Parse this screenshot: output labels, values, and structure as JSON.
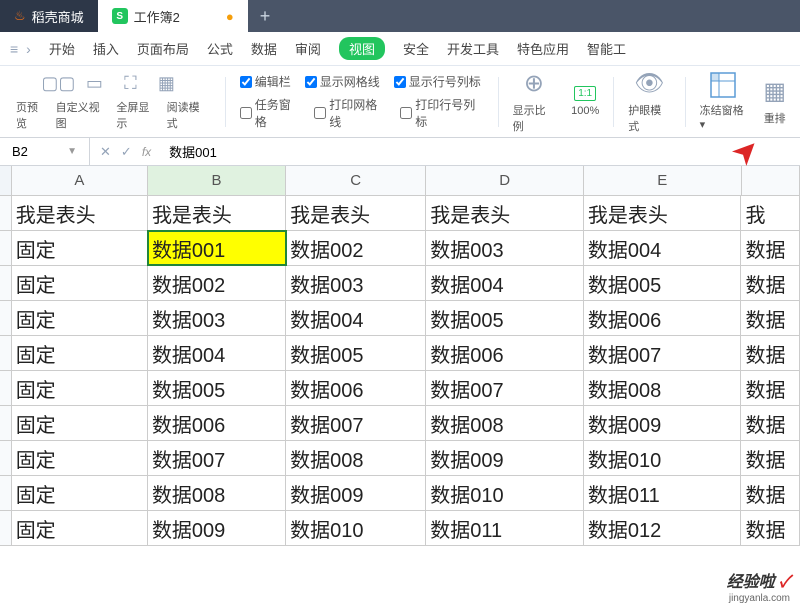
{
  "tabs": {
    "store": "稻壳商城",
    "workbook": "工作簿2",
    "add": "+"
  },
  "menu": {
    "items": [
      "开始",
      "插入",
      "页面布局",
      "公式",
      "数据",
      "审阅",
      "视图",
      "安全",
      "开发工具",
      "特色应用",
      "智能工"
    ]
  },
  "ribbon": {
    "group1_labels": [
      "页预览",
      "自定义视图",
      "全屏显示",
      "阅读模式"
    ],
    "checks": {
      "row1": [
        "编辑栏",
        "显示网格线",
        "显示行号列标"
      ],
      "row2": [
        "任务窗格",
        "打印网格线",
        "打印行号列标"
      ]
    },
    "zoom_label": "显示比例",
    "zoom_value": "100%",
    "ratio_text": "1:1",
    "eye_mode": "护眼模式",
    "freeze": "冻结窗格",
    "rearrange": "重排"
  },
  "formula_bar": {
    "cell_ref": "B2",
    "fx": "fx",
    "value": "数据001"
  },
  "sheet": {
    "columns": [
      "A",
      "B",
      "C",
      "D",
      "E"
    ],
    "headers": [
      "我是表头",
      "我是表头",
      "我是表头",
      "我是表头",
      "我是表头",
      "我"
    ],
    "rows": [
      [
        "固定",
        "数据001",
        "数据002",
        "数据003",
        "数据004",
        "数据"
      ],
      [
        "固定",
        "数据002",
        "数据003",
        "数据004",
        "数据005",
        "数据"
      ],
      [
        "固定",
        "数据003",
        "数据004",
        "数据005",
        "数据006",
        "数据"
      ],
      [
        "固定",
        "数据004",
        "数据005",
        "数据006",
        "数据007",
        "数据"
      ],
      [
        "固定",
        "数据005",
        "数据006",
        "数据007",
        "数据008",
        "数据"
      ],
      [
        "固定",
        "数据006",
        "数据007",
        "数据008",
        "数据009",
        "数据"
      ],
      [
        "固定",
        "数据007",
        "数据008",
        "数据009",
        "数据010",
        "数据"
      ],
      [
        "固定",
        "数据008",
        "数据009",
        "数据010",
        "数据011",
        "数据"
      ],
      [
        "固定",
        "数据009",
        "数据010",
        "数据011",
        "数据012",
        "数据"
      ]
    ]
  },
  "watermark": {
    "text": "经验啦",
    "url": "jingyanla.com"
  }
}
